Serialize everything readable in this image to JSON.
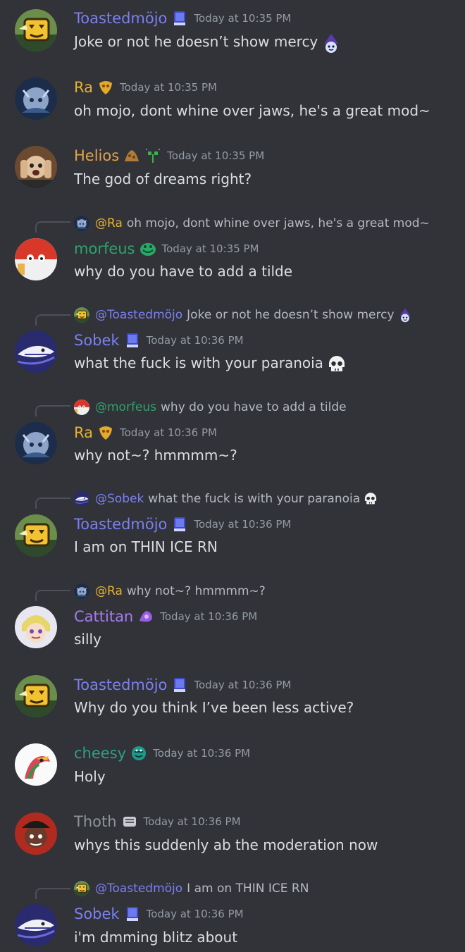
{
  "colors": {
    "toasted": "#7b7ff2",
    "ra": "#e7b22f",
    "helios": "#e0a44a",
    "morfeus": "#2ea36b",
    "sobek": "#7b7ff2",
    "cattitan": "#a67bf0",
    "cheesy": "#2e9f86",
    "thoth": "#8f9499",
    "time": "#949ba4"
  },
  "messages": [
    {
      "author": "Toastedmöjo",
      "badge": "blue-book-icon",
      "time": "Today at 10:35 PM",
      "content": "Joke or not he doesn’t show mercy",
      "content_emoji": "wizard-cat-emoji"
    },
    {
      "author": "Ra",
      "badge": "gold-mask-icon",
      "time": "Today at 10:35 PM",
      "content": "oh mojo, dont whine over jaws, he's a great mod~"
    },
    {
      "author": "Helios",
      "badge": "bronze-pile-icon",
      "badge2": "sprout-icon",
      "time": "Today at 10:35 PM",
      "content": "The god of dreams right?"
    },
    {
      "reply": {
        "name": "@Ra",
        "text": "oh mojo, dont whine over jaws, he's a great mod~"
      },
      "author": "morfeus",
      "badge": "green-frog-icon",
      "time": "Today at 10:35 PM",
      "content": "why do you have to add a tilde"
    },
    {
      "reply": {
        "name": "@Toastedmöjo",
        "text": "Joke or not he doesn’t show mercy"
      },
      "author": "Sobek",
      "badge": "blue-book-icon",
      "time": "Today at 10:36 PM",
      "content": "what the fuck is with your paranoia",
      "content_emoji": "skull-emoji"
    },
    {
      "reply": {
        "name": "@morfeus",
        "text": "why do you have to add a tilde"
      },
      "author": "Ra",
      "badge": "gold-mask-icon",
      "time": "Today at 10:36 PM",
      "content": "why not~? hmmmm~?"
    },
    {
      "reply": {
        "name": "@Sobek",
        "text": "what the fuck is with your paranoia"
      },
      "author": "Toastedmöjo",
      "badge": "blue-book-icon",
      "time": "Today at 10:36 PM",
      "content": "I am on THIN ICE RN"
    },
    {
      "reply": {
        "name": "@Ra",
        "text": "why not~? hmmmm~?"
      },
      "author": "Cattitan",
      "badge": "purple-potion-icon",
      "time": "Today at 10:36 PM",
      "content": "silly"
    },
    {
      "author": "Toastedmöjo",
      "badge": "blue-book-icon",
      "time": "Today at 10:36 PM",
      "content": "Why do you think I’ve been less active?"
    },
    {
      "author": "cheesy",
      "badge": "teal-dragon-icon",
      "time": "Today at 10:36 PM",
      "content": "Holy"
    },
    {
      "author": "Thoth",
      "badge": "grey-scroll-icon",
      "time": "Today at 10:36 PM",
      "content": "whys this suddenly ab the moderation now"
    },
    {
      "reply": {
        "name": "@Toastedmöjo",
        "text": "I am on THIN ICE RN"
      },
      "author": "Sobek",
      "badge": "blue-book-icon",
      "time": "Today at 10:36 PM",
      "content": "i'm dmming blitz about"
    }
  ]
}
